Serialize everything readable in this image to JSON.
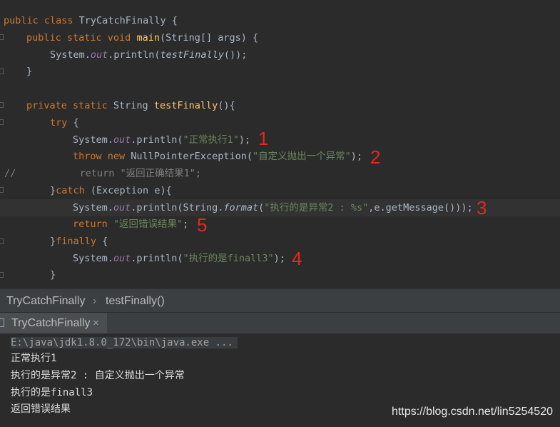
{
  "editor": {
    "line1": {
      "kw": "public class ",
      "name": "TryCatchFinally",
      "rest": " {"
    },
    "line2": {
      "kw": "public static void ",
      "fn": "main",
      "rest": "(String[] args) {"
    },
    "line3": {
      "pre": "System.",
      "field": "out",
      "mid": ".println(",
      "call": "testFinally",
      "post": "());"
    },
    "line4": {
      "text": "}"
    },
    "line6": {
      "kw": "private static ",
      "type": "String ",
      "fn": "testFinally",
      "rest": "(){"
    },
    "line7": {
      "kw": "try",
      "rest": " {"
    },
    "line8": {
      "pre": "System.",
      "field": "out",
      "mid": ".println(",
      "str": "\"正常执行1\"",
      "post": ");"
    },
    "line9": {
      "kw1": "throw new ",
      "cls": "NullPointerException(",
      "str": "\"自定义抛出一个异常\"",
      "post": ");"
    },
    "line10": {
      "text": "//           return \"返回正确结果1\";"
    },
    "line11": {
      "pre": "}",
      "kw": "catch",
      "rest": " (Exception e){"
    },
    "line12": {
      "pre": "System.",
      "field": "out",
      "mid": ".println(String.",
      "call": "format",
      "open": "(",
      "str": "\"执行的是异常2 : %s\"",
      "post": ",e.getMessage()));"
    },
    "line13": {
      "kw": "return ",
      "str": "\"返回错误结果\"",
      "post": ";"
    },
    "line14": {
      "pre": "}",
      "kw": "finally",
      "rest": " {"
    },
    "line15": {
      "pre": "System.",
      "field": "out",
      "mid": ".println(",
      "str": "\"执行的是finall3\"",
      "post": ");"
    },
    "line16": {
      "text": "}"
    }
  },
  "annotations": [
    "1",
    "2",
    "3",
    "4",
    "5"
  ],
  "breadcrumb": {
    "class_name": "TryCatchFinally",
    "separator": "›",
    "method": "testFinally()"
  },
  "run_tab": {
    "label": "TryCatchFinally",
    "close": "×"
  },
  "console": {
    "command": "E:\\java\\jdk1.8.0_172\\bin\\java.exe ...",
    "output": [
      "正常执行1",
      "执行的是异常2 : 自定义抛出一个异常",
      "执行的是finall3",
      "返回错误结果"
    ]
  },
  "watermark": "https://blog.csdn.net/lin5254520"
}
